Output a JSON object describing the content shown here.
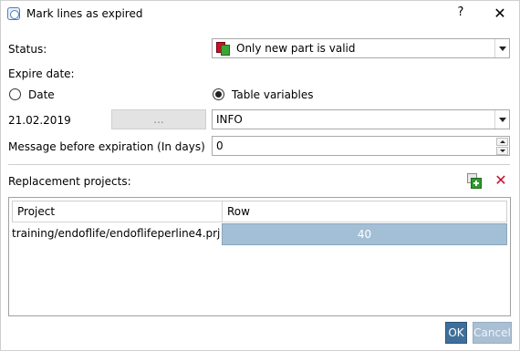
{
  "window": {
    "title": "Mark lines as expired",
    "help": "?",
    "close": "✕"
  },
  "status": {
    "label": "Status:",
    "value": "Only new part is valid"
  },
  "expire": {
    "label": "Expire date:",
    "radio_date": "Date",
    "radio_table": "Table variables",
    "selected": "Table variables",
    "date_value": "21.02.2019",
    "dots_button": "...",
    "variable_value": "INFO"
  },
  "message": {
    "label": "Message before expiration (In days)",
    "value": "0"
  },
  "replacement": {
    "label": "Replacement projects:",
    "columns": [
      "Project",
      "Row"
    ],
    "rows": [
      {
        "project": "training/endoflife/endoflifeperline4.prj",
        "row": "40"
      }
    ]
  },
  "buttons": {
    "ok": "OK",
    "cancel": "Cancel"
  },
  "colors": {
    "accent": "#3e6f9a",
    "selected_cell": "#a3bfd6",
    "delete": "#c8102e",
    "add": "#2e9a2e"
  }
}
